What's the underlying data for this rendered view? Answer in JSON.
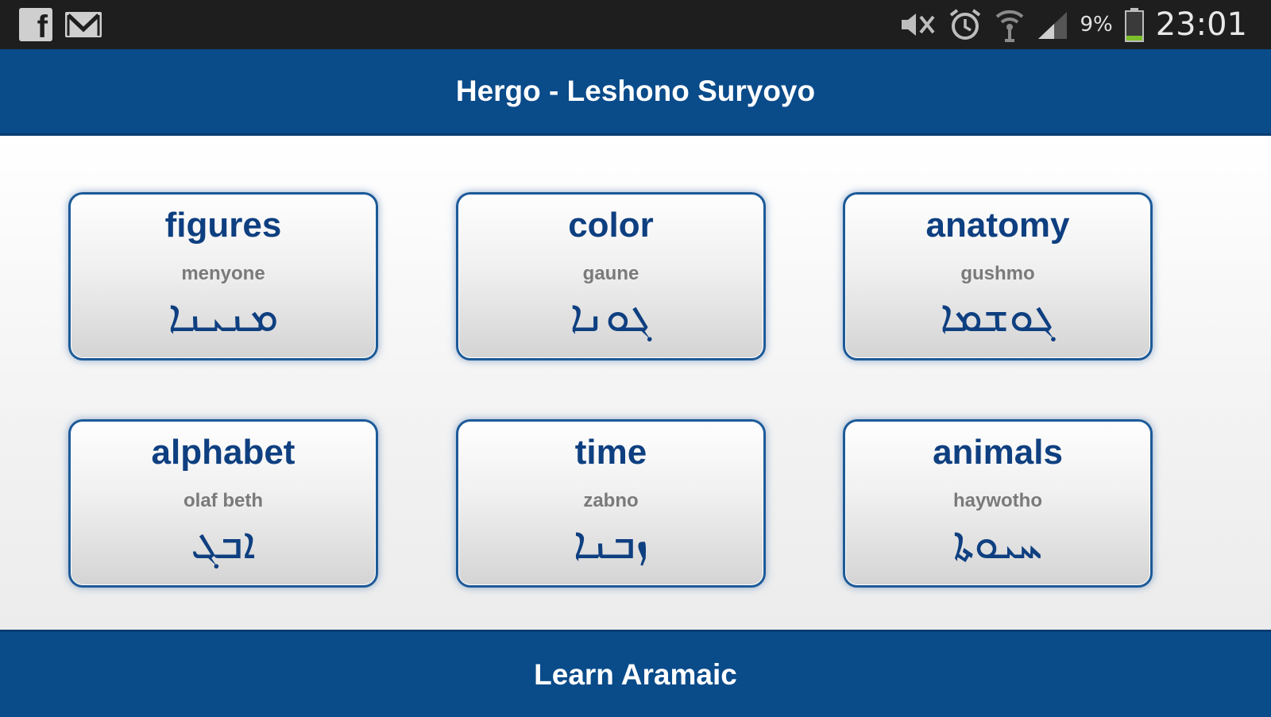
{
  "status_bar": {
    "left_icons": [
      "facebook-icon",
      "gmail-icon"
    ],
    "right_icons": [
      "mute-icon",
      "alarm-icon",
      "wifi-icon",
      "signal-icon",
      "battery-icon"
    ],
    "battery_percent": "9%",
    "time": "23:01"
  },
  "header": {
    "title": "Hergo - Leshono Suryoyo"
  },
  "categories": [
    {
      "title": "figures",
      "subtitle": "menyone",
      "syriac": "ܡܢܝܢܐ"
    },
    {
      "title": "color",
      "subtitle": "gaune",
      "syriac": "ܓܘܢܐ"
    },
    {
      "title": "anatomy",
      "subtitle": "gushmo",
      "syriac": "ܓܘܫܡܐ"
    },
    {
      "title": "alphabet",
      "subtitle": "olaf beth",
      "syriac": "ܐܒܓ"
    },
    {
      "title": "time",
      "subtitle": "zabno",
      "syriac": "ܙܒܢܐ"
    },
    {
      "title": "animals",
      "subtitle": "haywotho",
      "syriac": "ܚܝܘܬܐ"
    }
  ],
  "footer": {
    "label": "Learn Aramaic"
  },
  "colors": {
    "brand_blue": "#0a4b8a",
    "tile_text_blue": "#0e3f80",
    "subtitle_gray": "#7a7a7a",
    "status_bar_bg": "#1e1e1e"
  }
}
